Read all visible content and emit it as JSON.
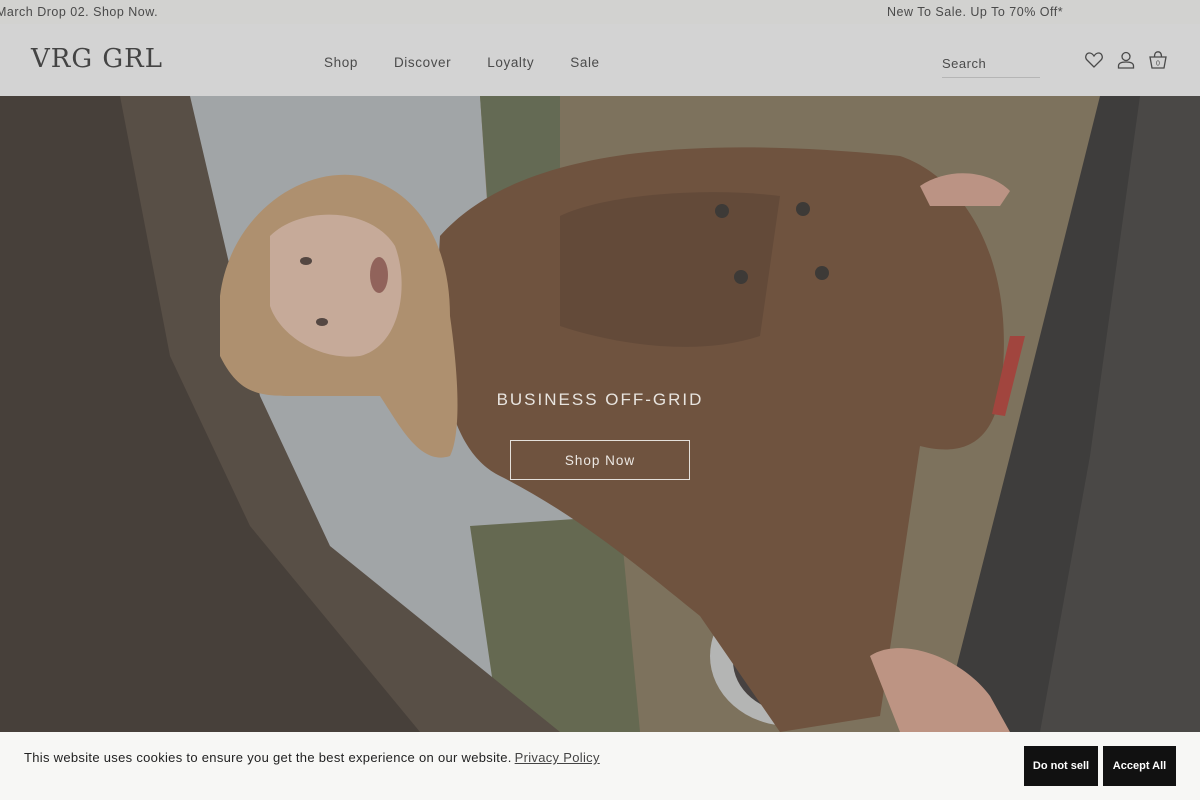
{
  "announcement": {
    "left_message": "March Drop 02. Shop Now.",
    "right_message": "New To Sale. Up To 70% Off*"
  },
  "header": {
    "logo": "VRG GRL",
    "nav": [
      {
        "label": "Shop"
      },
      {
        "label": "Discover"
      },
      {
        "label": "Loyalty"
      },
      {
        "label": "Sale"
      }
    ],
    "search_placeholder": "Search",
    "icons": [
      "heart-icon",
      "user-icon",
      "bag-icon"
    ],
    "bag_count": "0"
  },
  "hero": {
    "title": "BUSINESS OFF-GRID",
    "cta_label": "Shop Now"
  },
  "cookie_banner": {
    "message": "This website uses cookies to ensure you get the best experience on our website.",
    "privacy_link": "Privacy Policy",
    "do_not_sell_label": "Do not sell",
    "accept_label": "Accept All"
  }
}
